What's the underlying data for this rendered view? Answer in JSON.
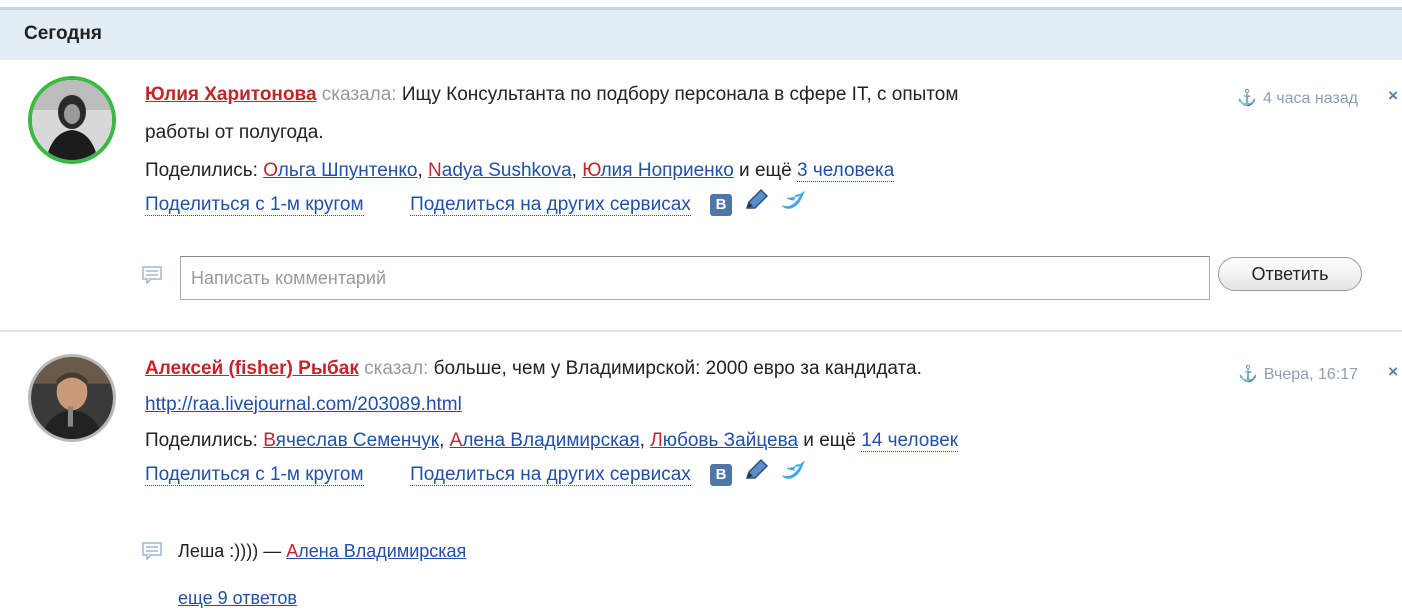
{
  "section": {
    "title": "Сегодня"
  },
  "posts": [
    {
      "author_first": "Ю",
      "author_rest": "лия Харитонова",
      "said": "сказала:",
      "text_line1": "Ищу Консультанта по подбору персонала в сфере IT, с опытом",
      "text_line2": "работы от полугода.",
      "time": "4 часа назад",
      "shared_label": "Поделились:",
      "sharers": [
        {
          "first": "О",
          "rest": "льга Шпунтенко"
        },
        {
          "first": "N",
          "rest": "adya Sushkova"
        },
        {
          "first": "Ю",
          "rest": "лия Ноприенко"
        }
      ],
      "and_more": "и ещё",
      "more_count": "3 человека",
      "share_circle": "Поделиться с 1-м кругом",
      "share_other": "Поделиться на других сервисах",
      "comment_placeholder": "Написать комментарий",
      "reply_label": "Ответить"
    },
    {
      "author_first": "А",
      "author_rest": "лексей (fisher) Рыбак",
      "said": "сказал:",
      "text_line1": "больше, чем у Владимирской: 2000 евро за кандидата.",
      "link": "http://raa.livejournal.com/203089.html",
      "time": "Вчера, 16:17",
      "shared_label": "Поделились:",
      "sharers": [
        {
          "first": "В",
          "rest": "ячеслав Семенчук"
        },
        {
          "first": "А",
          "rest": "лена Владимирская"
        },
        {
          "first": "Л",
          "rest": "юбовь Зайцева"
        }
      ],
      "and_more": "и ещё",
      "more_count": "14 человек",
      "share_circle": "Поделиться с 1-м кругом",
      "share_other": "Поделиться на других сервисах",
      "comment_text": "Леша :)))) —",
      "comment_author_first": "А",
      "comment_author_rest": "лена Владимирская",
      "more_replies": "еще 9 ответов"
    }
  ],
  "icons": {
    "vk_letter": "В",
    "close": "×",
    "anchor": "⚓"
  },
  "colors": {
    "author_red": "#c0262a",
    "link_blue": "#2050a8",
    "header_bg": "#e3edf6",
    "avatar_ring": "#3cb844"
  }
}
